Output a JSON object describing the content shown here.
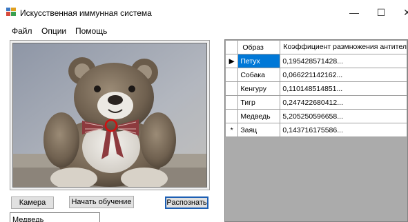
{
  "window": {
    "title": "Искусственная иммунная система",
    "minimize_glyph": "—",
    "maximize_glyph": "☐",
    "close_glyph": "✕"
  },
  "menu": {
    "items": [
      {
        "label": "Файл"
      },
      {
        "label": "Опции"
      },
      {
        "label": "Помощь"
      }
    ]
  },
  "buttons": {
    "camera": "Камера",
    "train": "Начать обучение",
    "recognize": "Распознать"
  },
  "result_textbox": {
    "value": "Медведь"
  },
  "grid": {
    "headers": {
      "pattern": "Образ",
      "coefficient": "Коэффициент размножения антител"
    },
    "rows": [
      {
        "marker": "▶",
        "pattern": "Петух",
        "coefficient": "0,195428571428...",
        "selected": true
      },
      {
        "marker": "",
        "pattern": "Собака",
        "coefficient": "0,066221142162...",
        "selected": false
      },
      {
        "marker": "",
        "pattern": "Кенгуру",
        "coefficient": "0,110148514851...",
        "selected": false
      },
      {
        "marker": "",
        "pattern": "Тигр",
        "coefficient": "0,247422680412...",
        "selected": false
      },
      {
        "marker": "",
        "pattern": "Медведь",
        "coefficient": "5,205250596658...",
        "selected": false
      },
      {
        "marker": "*",
        "pattern": "Заяц",
        "coefficient": "0,143716175586...",
        "selected": false
      }
    ]
  },
  "photo": {
    "subject": "teddy-bear",
    "marker_color": "#d01010"
  },
  "colors": {
    "selection": "#0078d7",
    "focus_border": "#1d5fb4",
    "grid_background": "#ababab"
  }
}
